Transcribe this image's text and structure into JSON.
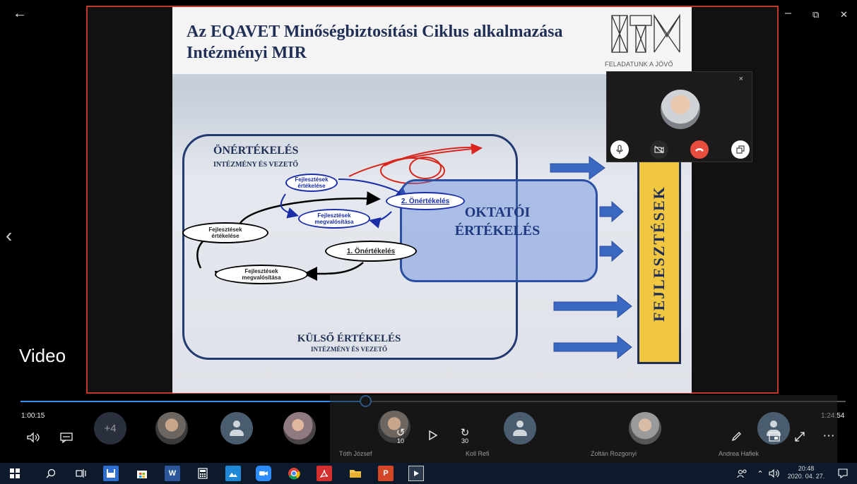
{
  "window": {
    "back_icon": "←",
    "minimize": "–",
    "restore": "⧉",
    "close": "✕"
  },
  "slide": {
    "title": "Az EQAVET Minőségbiztosítási Ciklus alkalmazása\nIntézményi MIR",
    "logo_text": "ITM",
    "logo_sub": "FELADATUNK A JÖVŐ",
    "onertekeles": "ÖNÉRTÉKELÉS",
    "onertekeles_sub": "INTÉZMÉNY ÉS VEZETŐ",
    "oktatoi": "OKTATÓI\nÉRTÉKELÉS",
    "kulso": "KÜLSŐ ÉRTÉKELÉS",
    "kulso_sub": "INTÉZMÉNY ÉS VEZETŐ",
    "fejlesztesek": "FEJLESZTÉSEK",
    "ovals": {
      "fejl_ert_top": "Fejlesztések\nértékelése",
      "onert2": "2. Önértékelés",
      "fejl_megv_top": "Fejlesztések\nmegvalósítása",
      "fejl_ert_left": "Fejlesztések\nértékelése",
      "onert1": "1. Önértékelés",
      "fejl_megv_bottom": "Fejlesztések\nmegvalósítása"
    }
  },
  "mini_call": {
    "close": "×"
  },
  "player": {
    "label": "Video",
    "elapsed": "1:00:15",
    "total": "1:24:54",
    "progress": 0.4174,
    "more_participants": "+4",
    "skip_back": "10",
    "skip_forward": "30",
    "more": "⋯"
  },
  "participants": [
    {
      "name": "Tóth József"
    },
    {
      "name": "Koll Refi"
    },
    {
      "name": "Zoltán Rozgonyi"
    },
    {
      "name": "Andrea Hafiek"
    }
  ],
  "taskbar": {
    "time": "20:48",
    "date": "2020. 04. 27."
  },
  "colors": {
    "accent": "#2f8ff3",
    "frame": "#c0392b",
    "hangup": "#e74c3c",
    "slide_navy": "#1f2f55",
    "slide_yellow": "#f1c640"
  }
}
